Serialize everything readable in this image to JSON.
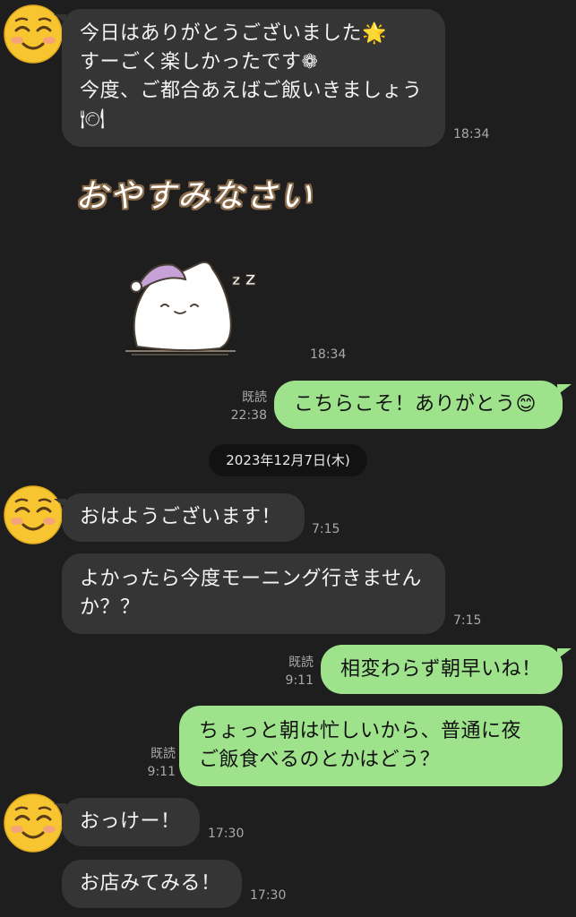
{
  "messages": {
    "m1": {
      "text": "今日はありがとうございました🌟\nすーごく楽しかったです❁\n今度、ご都合あえばご飯いきましょう🍽",
      "time": "18:34"
    },
    "sticker": {
      "text": "おやすみなさい",
      "zzz": "z Z",
      "time": "18:34"
    },
    "m2": {
      "text": "こちらこそ！ありがとう😊",
      "read": "既読",
      "time": "22:38"
    },
    "date_divider": "2023年12月7日(木)",
    "m3": {
      "text": "おはようございます！",
      "time": "7:15"
    },
    "m4": {
      "text": "よかったら今度モーニング行きませんか？？",
      "time": "7:15"
    },
    "m5": {
      "text": "相変わらず朝早いね！",
      "read": "既読",
      "time": "9:11"
    },
    "m6": {
      "text": "ちょっと朝は忙しいから、普通に夜\nご飯食べるのとかはどう？",
      "read": "既読",
      "time": "9:11"
    },
    "m7": {
      "text": "おっけー！",
      "time": "17:30"
    },
    "m8": {
      "text": "お店みてみる！",
      "time": "17:30"
    }
  },
  "colors": {
    "background": "#1e1e1e",
    "incoming_bubble": "#353535",
    "outgoing_bubble": "#9ee38b",
    "timestamp": "#a9a9a9"
  },
  "icons": {
    "avatar": "smiling-face-icon",
    "sticker": "sleeping-cat-sticker"
  }
}
